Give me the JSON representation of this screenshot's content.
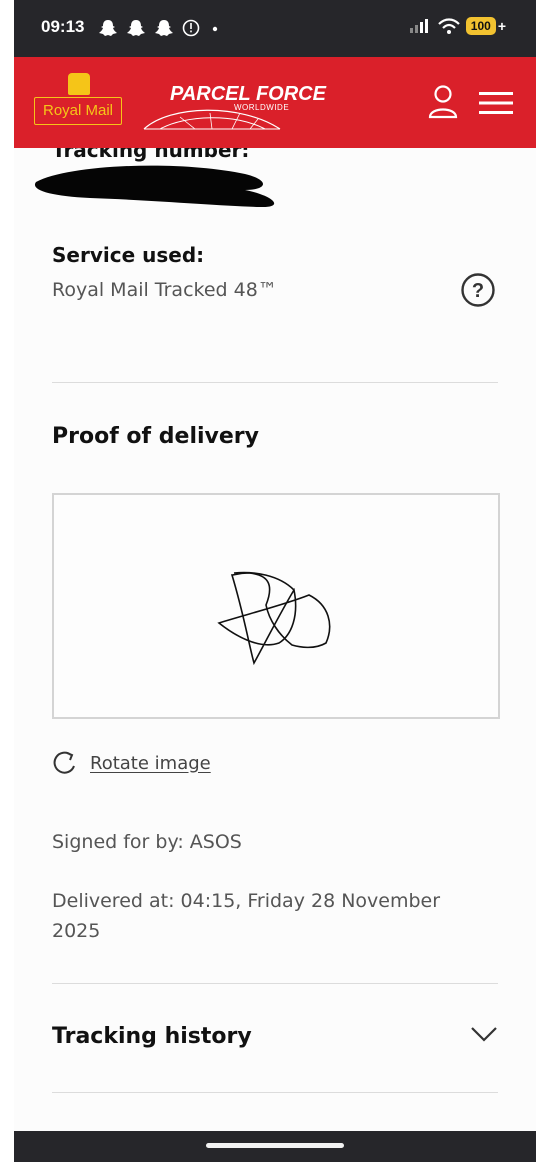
{
  "status_bar": {
    "time": "09:13",
    "battery": "100",
    "battery_suffix": "+"
  },
  "header": {
    "royal_mail_logo_text": "Royal Mail",
    "parcelforce_logo_text": "PARCEL FORCE",
    "parcelforce_sub_text": "WORLDWIDE",
    "brand_color": "#da202a",
    "logo_color": "#f5c518"
  },
  "details": {
    "tracking_label": "Tracking number:",
    "service_label": "Service used:",
    "service_value": "Royal Mail Tracked 48™"
  },
  "proof_of_delivery": {
    "title": "Proof of delivery",
    "rotate_label": "Rotate image",
    "signed_by": "Signed for by: ASOS",
    "delivered_at": "Delivered at: 04:15, Friday 28 November 2025"
  },
  "tracking_history": {
    "title": "Tracking history"
  },
  "icons": {
    "help": "help-icon",
    "user": "user-icon",
    "menu": "menu-icon",
    "rotate": "rotate-icon",
    "chevron": "chevron-down-icon"
  }
}
